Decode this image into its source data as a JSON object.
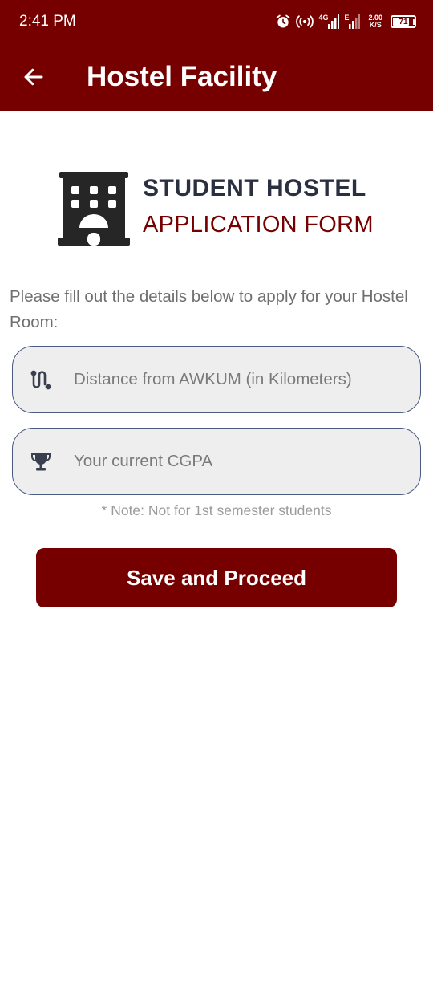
{
  "status_bar": {
    "time": "2:41 PM",
    "network_label": "4G",
    "network_label_2": "E",
    "net_speed_value": "2.00",
    "net_speed_unit": "K/S",
    "battery_level": "71",
    "icons": [
      "alarm-icon",
      "hotspot-icon",
      "signal-icon",
      "signal-icon",
      "battery-icon"
    ]
  },
  "app_bar": {
    "title": "Hostel Facility",
    "back_icon": "arrow-back-icon"
  },
  "header": {
    "icon": "building-icon",
    "title": "STUDENT HOSTEL",
    "subtitle": "APPLICATION FORM"
  },
  "form": {
    "instructions": "Please fill out the details below to apply for your Hostel Room:",
    "distance_field": {
      "icon": "route-icon",
      "placeholder": "Distance from AWKUM (in Kilometers)",
      "value": ""
    },
    "cgpa_field": {
      "icon": "trophy-icon",
      "placeholder": "Your current CGPA",
      "value": ""
    },
    "note": "* Note: Not for 1st semester students",
    "submit_label": "Save and Proceed"
  },
  "colors": {
    "primary": "#760000",
    "field_background": "#eeeeee",
    "field_border": "#4a5a80",
    "heading_dark": "#2b3040"
  }
}
